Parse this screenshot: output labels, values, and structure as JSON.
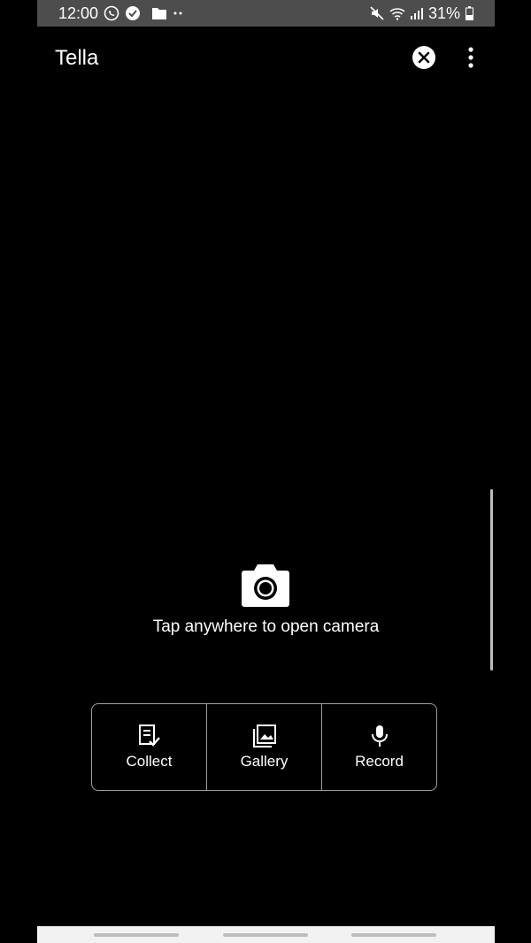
{
  "status_bar": {
    "time": "12:00",
    "battery": "31%",
    "left_icons": [
      "whatsapp-icon",
      "checkmark-shield-icon",
      "folder-icon",
      "more-dots-icon"
    ],
    "right_icons": [
      "mute-icon",
      "wifi-icon",
      "signal-icon",
      "battery-icon"
    ]
  },
  "app_bar": {
    "title": "Tella",
    "close_icon": "close-circle-icon",
    "menu_icon": "vertical-dots-icon"
  },
  "camera": {
    "icon": "camera-icon",
    "hint": "Tap anywhere to open camera"
  },
  "actions": [
    {
      "label": "Collect",
      "icon": "clipboard-check-icon"
    },
    {
      "label": "Gallery",
      "icon": "gallery-icon"
    },
    {
      "label": "Record",
      "icon": "microphone-icon"
    }
  ],
  "colors": {
    "background": "#000000",
    "status_bar": "#4d4d4d",
    "text": "#ffffff",
    "border": "#9e9e9e",
    "nav_bar": "#f2f2f2"
  }
}
